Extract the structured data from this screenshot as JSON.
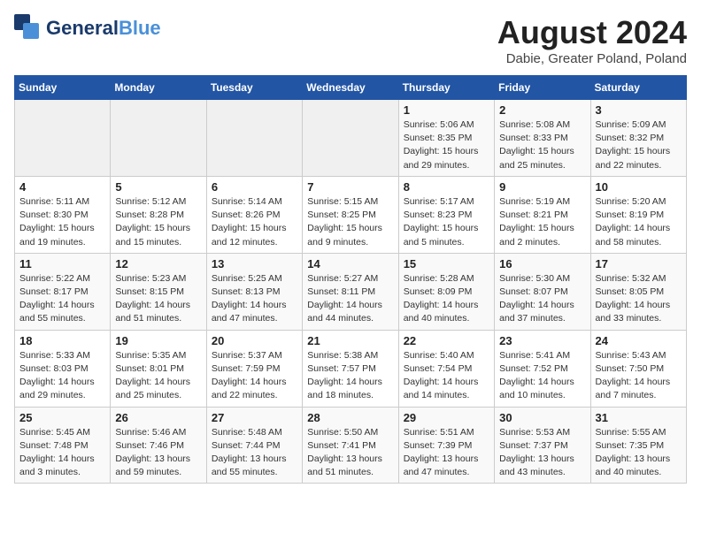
{
  "header": {
    "logo_general": "General",
    "logo_blue": "Blue",
    "main_title": "August 2024",
    "subtitle": "Dabie, Greater Poland, Poland"
  },
  "calendar": {
    "days_of_week": [
      "Sunday",
      "Monday",
      "Tuesday",
      "Wednesday",
      "Thursday",
      "Friday",
      "Saturday"
    ],
    "weeks": [
      [
        {
          "day": "",
          "info": ""
        },
        {
          "day": "",
          "info": ""
        },
        {
          "day": "",
          "info": ""
        },
        {
          "day": "",
          "info": ""
        },
        {
          "day": "1",
          "info": "Sunrise: 5:06 AM\nSunset: 8:35 PM\nDaylight: 15 hours\nand 29 minutes."
        },
        {
          "day": "2",
          "info": "Sunrise: 5:08 AM\nSunset: 8:33 PM\nDaylight: 15 hours\nand 25 minutes."
        },
        {
          "day": "3",
          "info": "Sunrise: 5:09 AM\nSunset: 8:32 PM\nDaylight: 15 hours\nand 22 minutes."
        }
      ],
      [
        {
          "day": "4",
          "info": "Sunrise: 5:11 AM\nSunset: 8:30 PM\nDaylight: 15 hours\nand 19 minutes."
        },
        {
          "day": "5",
          "info": "Sunrise: 5:12 AM\nSunset: 8:28 PM\nDaylight: 15 hours\nand 15 minutes."
        },
        {
          "day": "6",
          "info": "Sunrise: 5:14 AM\nSunset: 8:26 PM\nDaylight: 15 hours\nand 12 minutes."
        },
        {
          "day": "7",
          "info": "Sunrise: 5:15 AM\nSunset: 8:25 PM\nDaylight: 15 hours\nand 9 minutes."
        },
        {
          "day": "8",
          "info": "Sunrise: 5:17 AM\nSunset: 8:23 PM\nDaylight: 15 hours\nand 5 minutes."
        },
        {
          "day": "9",
          "info": "Sunrise: 5:19 AM\nSunset: 8:21 PM\nDaylight: 15 hours\nand 2 minutes."
        },
        {
          "day": "10",
          "info": "Sunrise: 5:20 AM\nSunset: 8:19 PM\nDaylight: 14 hours\nand 58 minutes."
        }
      ],
      [
        {
          "day": "11",
          "info": "Sunrise: 5:22 AM\nSunset: 8:17 PM\nDaylight: 14 hours\nand 55 minutes."
        },
        {
          "day": "12",
          "info": "Sunrise: 5:23 AM\nSunset: 8:15 PM\nDaylight: 14 hours\nand 51 minutes."
        },
        {
          "day": "13",
          "info": "Sunrise: 5:25 AM\nSunset: 8:13 PM\nDaylight: 14 hours\nand 47 minutes."
        },
        {
          "day": "14",
          "info": "Sunrise: 5:27 AM\nSunset: 8:11 PM\nDaylight: 14 hours\nand 44 minutes."
        },
        {
          "day": "15",
          "info": "Sunrise: 5:28 AM\nSunset: 8:09 PM\nDaylight: 14 hours\nand 40 minutes."
        },
        {
          "day": "16",
          "info": "Sunrise: 5:30 AM\nSunset: 8:07 PM\nDaylight: 14 hours\nand 37 minutes."
        },
        {
          "day": "17",
          "info": "Sunrise: 5:32 AM\nSunset: 8:05 PM\nDaylight: 14 hours\nand 33 minutes."
        }
      ],
      [
        {
          "day": "18",
          "info": "Sunrise: 5:33 AM\nSunset: 8:03 PM\nDaylight: 14 hours\nand 29 minutes."
        },
        {
          "day": "19",
          "info": "Sunrise: 5:35 AM\nSunset: 8:01 PM\nDaylight: 14 hours\nand 25 minutes."
        },
        {
          "day": "20",
          "info": "Sunrise: 5:37 AM\nSunset: 7:59 PM\nDaylight: 14 hours\nand 22 minutes."
        },
        {
          "day": "21",
          "info": "Sunrise: 5:38 AM\nSunset: 7:57 PM\nDaylight: 14 hours\nand 18 minutes."
        },
        {
          "day": "22",
          "info": "Sunrise: 5:40 AM\nSunset: 7:54 PM\nDaylight: 14 hours\nand 14 minutes."
        },
        {
          "day": "23",
          "info": "Sunrise: 5:41 AM\nSunset: 7:52 PM\nDaylight: 14 hours\nand 10 minutes."
        },
        {
          "day": "24",
          "info": "Sunrise: 5:43 AM\nSunset: 7:50 PM\nDaylight: 14 hours\nand 7 minutes."
        }
      ],
      [
        {
          "day": "25",
          "info": "Sunrise: 5:45 AM\nSunset: 7:48 PM\nDaylight: 14 hours\nand 3 minutes."
        },
        {
          "day": "26",
          "info": "Sunrise: 5:46 AM\nSunset: 7:46 PM\nDaylight: 13 hours\nand 59 minutes."
        },
        {
          "day": "27",
          "info": "Sunrise: 5:48 AM\nSunset: 7:44 PM\nDaylight: 13 hours\nand 55 minutes."
        },
        {
          "day": "28",
          "info": "Sunrise: 5:50 AM\nSunset: 7:41 PM\nDaylight: 13 hours\nand 51 minutes."
        },
        {
          "day": "29",
          "info": "Sunrise: 5:51 AM\nSunset: 7:39 PM\nDaylight: 13 hours\nand 47 minutes."
        },
        {
          "day": "30",
          "info": "Sunrise: 5:53 AM\nSunset: 7:37 PM\nDaylight: 13 hours\nand 43 minutes."
        },
        {
          "day": "31",
          "info": "Sunrise: 5:55 AM\nSunset: 7:35 PM\nDaylight: 13 hours\nand 40 minutes."
        }
      ]
    ]
  }
}
